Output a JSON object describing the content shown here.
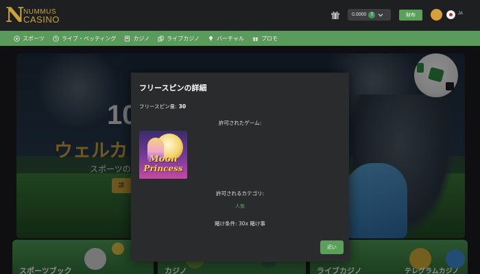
{
  "header": {
    "logo_line1": "NUMMUS",
    "logo_line2": "CASINO",
    "logo_mark": "N",
    "gift_icon": "gift-icon",
    "balance": "0.0000",
    "coin_symbol": "T",
    "deposit_label": "財布",
    "language": "JA"
  },
  "nav": {
    "items": [
      {
        "label": "スポーツ",
        "icon": "soccer-ball-icon"
      },
      {
        "label": "ライブ・ベッティング",
        "icon": "live-betting-icon"
      },
      {
        "label": "カジノ",
        "icon": "slot-machine-icon"
      },
      {
        "label": "ライブカジノ",
        "icon": "cards-icon"
      },
      {
        "label": "バーチャル",
        "icon": "diamond-icon"
      },
      {
        "label": "プロモ",
        "icon": "gift-icon"
      }
    ]
  },
  "banner": {
    "big_text": "10",
    "headline": "ウェルカ",
    "subline": "スポーツの",
    "cta": "請"
  },
  "cards": [
    {
      "label": "スポーツブック"
    },
    {
      "label": "カジノ"
    },
    {
      "label": "ライブカジノ"
    },
    {
      "label": "テレグラムカジノ"
    }
  ],
  "modal": {
    "title": "フリースピンの詳細",
    "freespin_label": "フリースピン量:",
    "freespin_value": "30",
    "allowed_games_label": "許可されたゲーム:",
    "game": {
      "line1": "Moon",
      "line2": "Princess"
    },
    "allowed_categories_label": "許可されるカテゴリ:",
    "category_value": "人気",
    "wager_text": "賭け条件: 30x 賭け事",
    "close_label": "近い"
  },
  "colors": {
    "accent_green": "#5aa05a",
    "gold": "#c9a13a",
    "modal_bg": "#2a2b2d",
    "header_bg": "#1e1f21"
  }
}
